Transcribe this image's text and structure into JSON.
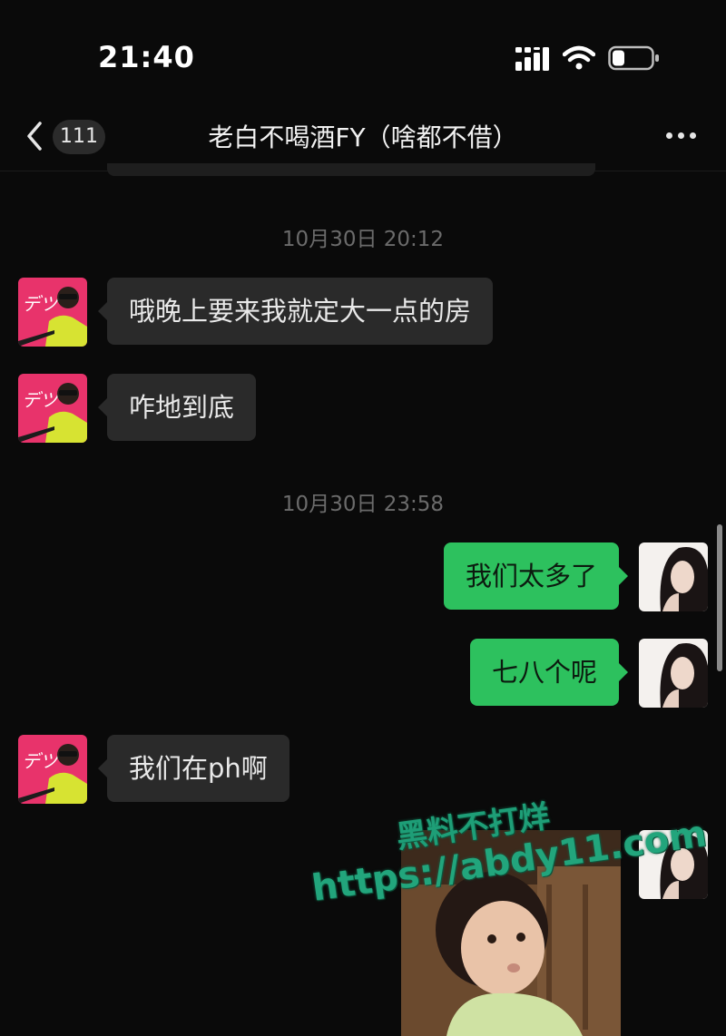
{
  "status_bar": {
    "time": "21:40",
    "signal_icon": "signal-bars-icon",
    "wifi_icon": "wifi-icon",
    "battery_icon": "battery-icon"
  },
  "nav": {
    "back_icon": "chevron-left-icon",
    "unread_count": "111",
    "title": "老白不喝酒FY（啥都不借）",
    "more_icon": "more-dots-icon"
  },
  "messages": [
    {
      "type": "timestamp",
      "text": "10月30日 20:12"
    },
    {
      "type": "text",
      "from": "contact",
      "text": "哦晚上要来我就定大一点的房"
    },
    {
      "type": "text",
      "from": "contact",
      "text": "咋地到底"
    },
    {
      "type": "timestamp",
      "text": "10月30日 23:58"
    },
    {
      "type": "text",
      "from": "self",
      "text": "我们太多了"
    },
    {
      "type": "text",
      "from": "self",
      "text": "七八个呢"
    },
    {
      "type": "text",
      "from": "contact",
      "text": "我们在ph啊"
    },
    {
      "type": "image",
      "from": "self",
      "description": "photo of a little girl"
    }
  ],
  "watermark": {
    "line1": "黑料不打烊",
    "line2": "https://abdy11.com"
  },
  "colors": {
    "background": "#0a0a0a",
    "incoming_bubble": "#2a2a2a",
    "outgoing_bubble": "#2dc15e",
    "timestamp_text": "#6b6b6b",
    "watermark": "#1e9e77"
  }
}
